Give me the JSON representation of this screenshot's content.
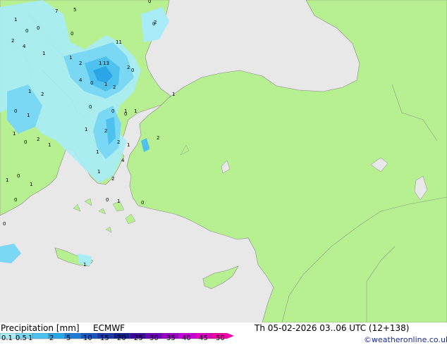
{
  "footer": {
    "title": "Precipitation [mm]",
    "model": "ECMWF",
    "valid_time": "Th 05-02-2026 03..06 UTC (12+138)",
    "credit": "©weatheronline.co.uk"
  },
  "legend": {
    "ticks": [
      "0.1",
      "0.5",
      "1",
      "2",
      "5",
      "10",
      "15",
      "20",
      "25",
      "30",
      "35",
      "40",
      "45",
      "50"
    ],
    "colors": [
      "#a8ecf8",
      "#7ad8f4",
      "#4ec2ee",
      "#2aa6e6",
      "#1e7ed6",
      "#1a58c0",
      "#1a38a8",
      "#10208a",
      "#3a0aa0",
      "#6a00b8",
      "#9a00c8",
      "#c800d8",
      "#e000c8",
      "#f000a8"
    ]
  },
  "map": {
    "colors": {
      "sea": "#e8e8e8",
      "land": "#b7f090",
      "border": "#8a9a8a",
      "coast": "#8a8a8a"
    },
    "point_labels": [
      "0",
      "1",
      "2",
      "4",
      "5",
      "7",
      "11",
      "13",
      "0",
      "1",
      "2",
      "4",
      "0",
      "1",
      "2",
      "1",
      "0",
      "2",
      "1",
      "0",
      "1",
      "2",
      "1",
      "1",
      "0",
      "1",
      "0",
      "2",
      "4",
      "1",
      "0",
      "2",
      "1",
      "2",
      "0",
      "1",
      "1",
      "2",
      "0",
      "1",
      "0",
      "1",
      "1",
      "2",
      "1",
      "0",
      "1",
      "0",
      "0",
      "0",
      "0",
      "1",
      "2",
      "0",
      "1"
    ]
  }
}
